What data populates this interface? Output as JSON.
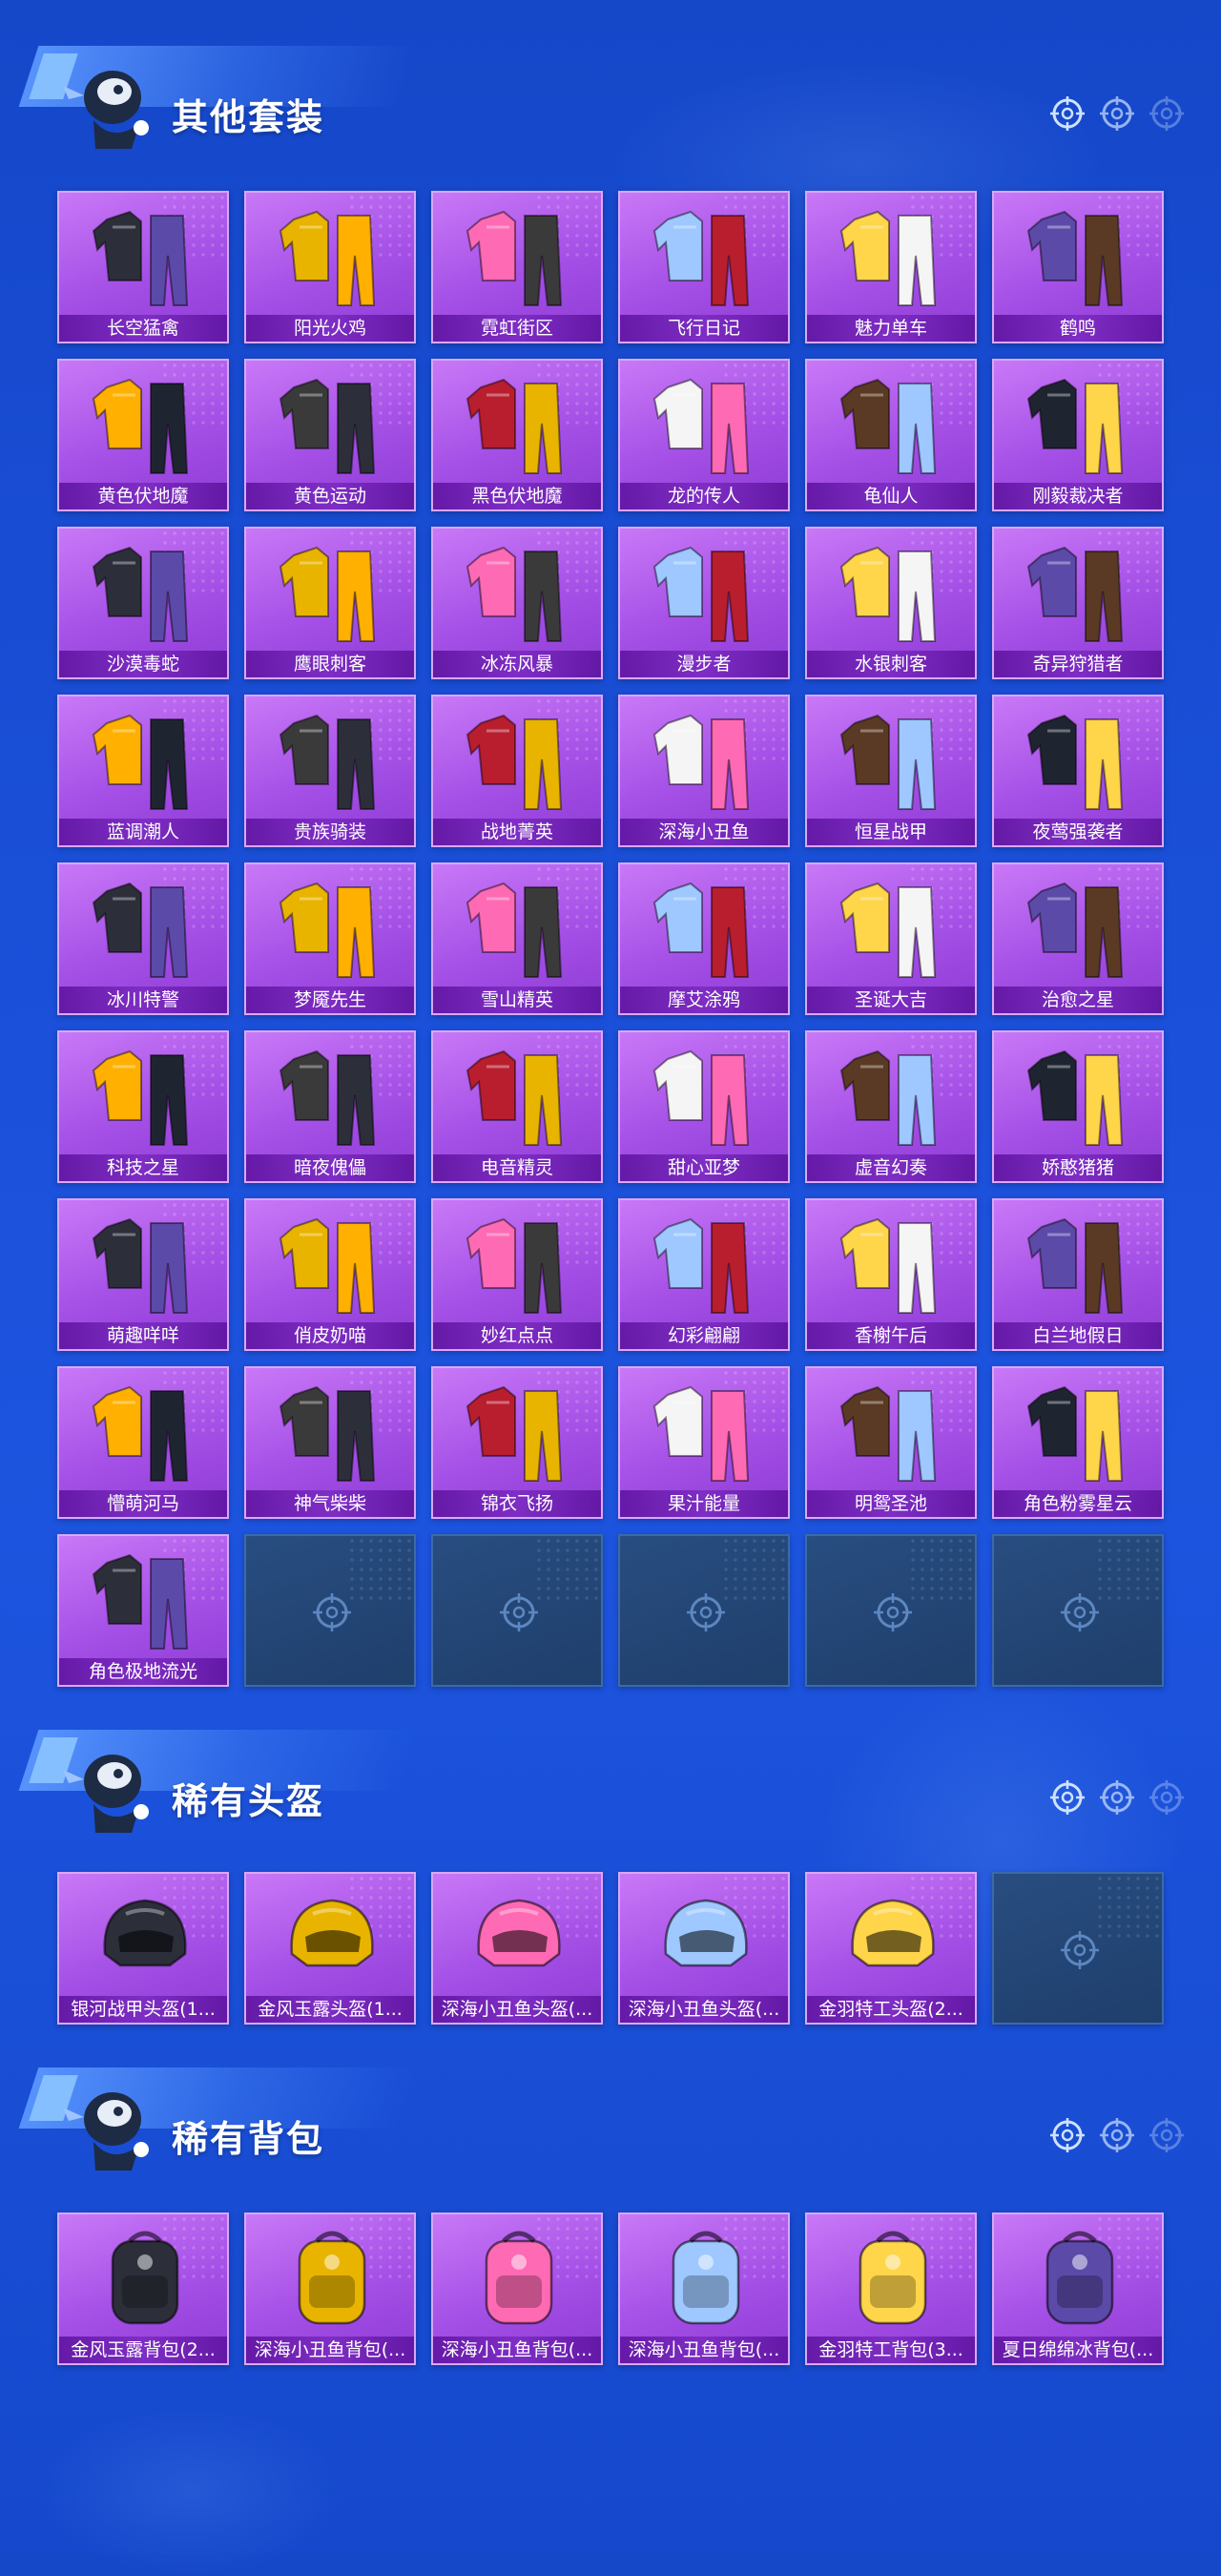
{
  "colors": {
    "bg": "#1a4fd8",
    "card": "#a44fe6",
    "card_label": "#6a1eb0",
    "empty": "#22436f"
  },
  "sections": [
    {
      "title": "其他套装",
      "items": [
        "长空猛禽",
        "阳光火鸡",
        "霓虹街区",
        "飞行日记",
        "魅力单车",
        "鹤鸣",
        "黄色伏地魔",
        "黄色运动",
        "黑色伏地魔",
        "龙的传人",
        "龟仙人",
        "刚毅裁决者",
        "沙漠毒蛇",
        "鹰眼刺客",
        "冰冻风暴",
        "漫步者",
        "水银刺客",
        "奇异狩猎者",
        "蓝调潮人",
        "贵族骑装",
        "战地菁英",
        "深海小丑鱼",
        "恒星战甲",
        "夜莺强袭者",
        "冰川特警",
        "梦魇先生",
        "雪山精英",
        "摩艾涂鸦",
        "圣诞大吉",
        "治愈之星",
        "科技之星",
        "暗夜傀儡",
        "电音精灵",
        "甜心亚梦",
        "虚音幻奏",
        "娇憨猪猪",
        "萌趣咩咩",
        "俏皮奶喵",
        "妙红点点",
        "幻彩翩翩",
        "香榭午后",
        "白兰地假日",
        "懵萌河马",
        "神气柴柴",
        "锦衣飞扬",
        "果汁能量",
        "明鸳圣池",
        "角色粉雾星云",
        "角色极地流光"
      ],
      "empty_slots": 5
    },
    {
      "title": "稀有头盔",
      "items": [
        "银河战甲头盔(1...",
        "金风玉露头盔(1...",
        "深海小丑鱼头盔(...",
        "深海小丑鱼头盔(...",
        "金羽特工头盔(2..."
      ],
      "empty_slots": 1
    },
    {
      "title": "稀有背包",
      "items": [
        "金风玉露背包(2...",
        "深海小丑鱼背包(...",
        "深海小丑鱼背包(...",
        "深海小丑鱼背包(...",
        "金羽特工背包(3...",
        "夏日绵绵冰背包(..."
      ],
      "empty_slots": 0
    }
  ]
}
